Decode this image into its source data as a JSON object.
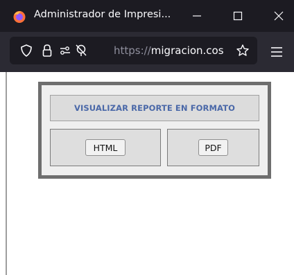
{
  "window": {
    "title": "Administrador de Impresi...",
    "controls": [
      "minimize-icon",
      "maximize-icon",
      "close-icon"
    ]
  },
  "toolbar": {
    "url_prefix": "https://",
    "url_domain": "migracion.cos",
    "icons": [
      "shield-icon",
      "lock-icon",
      "permissions-icon",
      "tracking-blocked-icon",
      "bookmark-star-icon",
      "hamburger-menu-icon"
    ]
  },
  "report": {
    "heading": "VISUALIZAR REPORTE EN FORMATO",
    "html_label": "HTML",
    "pdf_label": "PDF"
  },
  "colors": {
    "titlebar": "#1c1b22",
    "toolbar": "#2b2a33",
    "heading_text": "#4a68a8",
    "frame_border": "#6e6e6e",
    "cell_background": "#dcdcdc"
  }
}
